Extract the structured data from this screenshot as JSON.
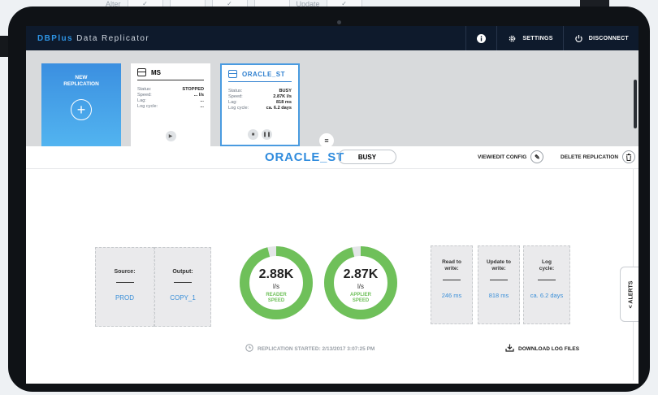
{
  "background": {
    "form_words": [
      "Alter",
      "Update"
    ]
  },
  "topbar": {
    "brand": "DBPlus",
    "title": "Data Replicator",
    "info_icon": "info-icon",
    "settings_label": "SETTINGS",
    "disconnect_label": "DISCONNECT"
  },
  "new_replication": {
    "label": "NEW REPLICATION",
    "icon": "plus-icon"
  },
  "replications": [
    {
      "name": "MS",
      "rows": [
        {
          "label": "Status:",
          "value": "STOPPED"
        },
        {
          "label": "Speed:",
          "value": "... l/s"
        },
        {
          "label": "Lag:",
          "value": "..."
        },
        {
          "label": "Log cycle:",
          "value": "..."
        }
      ],
      "controls": [
        "play-icon"
      ]
    },
    {
      "name": "ORACLE_ST",
      "selected": true,
      "rows": [
        {
          "label": "Status:",
          "value": "BUSY"
        },
        {
          "label": "Speed:",
          "value": "2.87K l/s"
        },
        {
          "label": "Lag:",
          "value": "818 ms"
        },
        {
          "label": "Log cycle:",
          "value": "ca. 6.2 days"
        }
      ],
      "controls": [
        "stop-icon",
        "pause-icon"
      ]
    }
  ],
  "detail": {
    "title": "ORACLE_ST",
    "status": "BUSY",
    "view_edit_config": "VIEW/EDIT CONFIG",
    "delete_replication": "DELETE REPLICATION",
    "source_label": "Source:",
    "source_value": "PROD",
    "output_label": "Output:",
    "output_value": "COPY_1",
    "reader": {
      "value": "2.88K",
      "unit": "l/s",
      "label": "READER SPEED",
      "fill": 0.96
    },
    "applier": {
      "value": "2.87K",
      "unit": "l/s",
      "label": "APPLIER SPEED",
      "fill": 0.96
    },
    "read_to_write": {
      "label": "Read to write:",
      "value": "246 ms"
    },
    "update_to_write": {
      "label": "Update to write:",
      "value": "818 ms"
    },
    "log_cycle": {
      "label": "Log cycle:",
      "value": "ca. 6.2 days"
    },
    "started": "REPLICATION STARTED: 2/13/2017 3:07:25 PM",
    "download_logs": "DOWNLOAD LOG FILES",
    "alerts": "ALERTS"
  },
  "colors": {
    "accent": "#2f8bdd",
    "gauge_green": "#6fc05a",
    "topbar": "#0e1a2c"
  }
}
